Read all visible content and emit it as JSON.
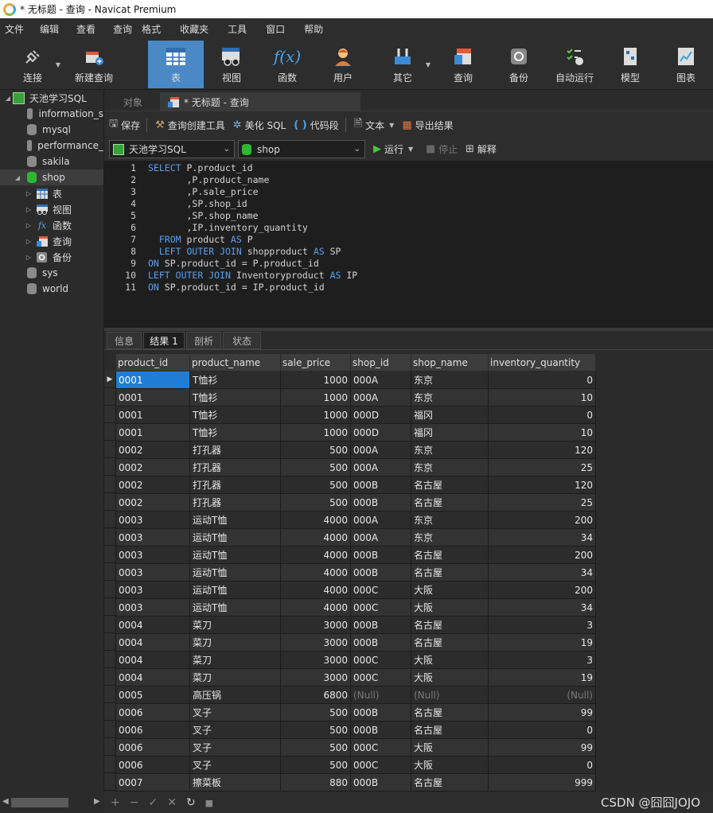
{
  "window": {
    "title": "* 无标题 - 查询 - Navicat Premium"
  },
  "menu": [
    "文件",
    "编辑",
    "查看",
    "查询",
    "格式",
    "收藏夹",
    "工具",
    "窗口",
    "帮助"
  ],
  "toolbar": [
    {
      "label": "连接",
      "icon": "plug-icon"
    },
    {
      "label": "新建查询",
      "icon": "new-query-icon"
    },
    {
      "label": "表",
      "icon": "table-icon",
      "active": true
    },
    {
      "label": "视图",
      "icon": "view-icon"
    },
    {
      "label": "函数",
      "icon": "function-icon"
    },
    {
      "label": "用户",
      "icon": "user-icon"
    },
    {
      "label": "其它",
      "icon": "tools-icon"
    },
    {
      "label": "查询",
      "icon": "query-icon"
    },
    {
      "label": "备份",
      "icon": "backup-icon"
    },
    {
      "label": "自动运行",
      "icon": "schedule-icon"
    },
    {
      "label": "模型",
      "icon": "model-icon"
    },
    {
      "label": "图表",
      "icon": "chart-icon"
    }
  ],
  "tree": {
    "connection": "天池学习SQL",
    "databases": [
      "information_s",
      "mysql",
      "performance_",
      "sakila",
      "shop"
    ],
    "shop_children": [
      "表",
      "视图",
      "函数",
      "查询",
      "备份"
    ],
    "others": [
      "sys",
      "world"
    ]
  },
  "tabs": {
    "objects": "对象",
    "query": "* 无标题 - 查询"
  },
  "query_toolbar": {
    "save": "保存",
    "builder": "查询创建工具",
    "beautify": "美化 SQL",
    "snippet": "代码段",
    "text": "文本",
    "export": "导出结果"
  },
  "conn_bar": {
    "connection": "天池学习SQL",
    "database": "shop",
    "run": "运行",
    "stop": "停止",
    "explain": "解释"
  },
  "editor": {
    "line_numbers": [
      "1",
      "2",
      "3",
      "4",
      "5",
      "6",
      "7",
      "8",
      "9",
      "10",
      "11"
    ],
    "lines": [
      "SELECT P.product_id",
      "       ,P.product_name",
      "       ,P.sale_price",
      "       ,SP.shop_id",
      "       ,SP.shop_name",
      "       ,IP.inventory_quantity",
      "  FROM product AS P",
      "  LEFT OUTER JOIN shopproduct AS SP",
      "ON SP.product_id = P.product_id",
      "LEFT OUTER JOIN Inventoryproduct AS IP",
      "ON SP.product_id = IP.product_id"
    ]
  },
  "result_tabs": [
    "信息",
    "结果 1",
    "剖析",
    "状态"
  ],
  "grid": {
    "columns": [
      "product_id",
      "product_name",
      "sale_price",
      "shop_id",
      "shop_name",
      "inventory_quantity"
    ],
    "rows": [
      [
        "0001",
        "T恤衫",
        "1000",
        "000A",
        "东京",
        "0"
      ],
      [
        "0001",
        "T恤衫",
        "1000",
        "000A",
        "东京",
        "10"
      ],
      [
        "0001",
        "T恤衫",
        "1000",
        "000D",
        "福冈",
        "0"
      ],
      [
        "0001",
        "T恤衫",
        "1000",
        "000D",
        "福冈",
        "10"
      ],
      [
        "0002",
        "打孔器",
        "500",
        "000A",
        "东京",
        "120"
      ],
      [
        "0002",
        "打孔器",
        "500",
        "000A",
        "东京",
        "25"
      ],
      [
        "0002",
        "打孔器",
        "500",
        "000B",
        "名古屋",
        "120"
      ],
      [
        "0002",
        "打孔器",
        "500",
        "000B",
        "名古屋",
        "25"
      ],
      [
        "0003",
        "运动T恤",
        "4000",
        "000A",
        "东京",
        "200"
      ],
      [
        "0003",
        "运动T恤",
        "4000",
        "000A",
        "东京",
        "34"
      ],
      [
        "0003",
        "运动T恤",
        "4000",
        "000B",
        "名古屋",
        "200"
      ],
      [
        "0003",
        "运动T恤",
        "4000",
        "000B",
        "名古屋",
        "34"
      ],
      [
        "0003",
        "运动T恤",
        "4000",
        "000C",
        "大阪",
        "200"
      ],
      [
        "0003",
        "运动T恤",
        "4000",
        "000C",
        "大阪",
        "34"
      ],
      [
        "0004",
        "菜刀",
        "3000",
        "000B",
        "名古屋",
        "3"
      ],
      [
        "0004",
        "菜刀",
        "3000",
        "000B",
        "名古屋",
        "19"
      ],
      [
        "0004",
        "菜刀",
        "3000",
        "000C",
        "大阪",
        "3"
      ],
      [
        "0004",
        "菜刀",
        "3000",
        "000C",
        "大阪",
        "19"
      ],
      [
        "0005",
        "高压锅",
        "6800",
        "(Null)",
        "(Null)",
        "(Null)"
      ],
      [
        "0006",
        "叉子",
        "500",
        "000B",
        "名古屋",
        "99"
      ],
      [
        "0006",
        "叉子",
        "500",
        "000B",
        "名古屋",
        "0"
      ],
      [
        "0006",
        "叉子",
        "500",
        "000C",
        "大阪",
        "99"
      ],
      [
        "0006",
        "叉子",
        "500",
        "000C",
        "大阪",
        "0"
      ],
      [
        "0007",
        "擦菜板",
        "880",
        "000B",
        "名古屋",
        "999"
      ]
    ]
  },
  "bottom_bar": [
    "+",
    "−",
    "✓",
    "✕",
    "↻",
    "■"
  ],
  "watermark": "CSDN @囧囧JOJO"
}
